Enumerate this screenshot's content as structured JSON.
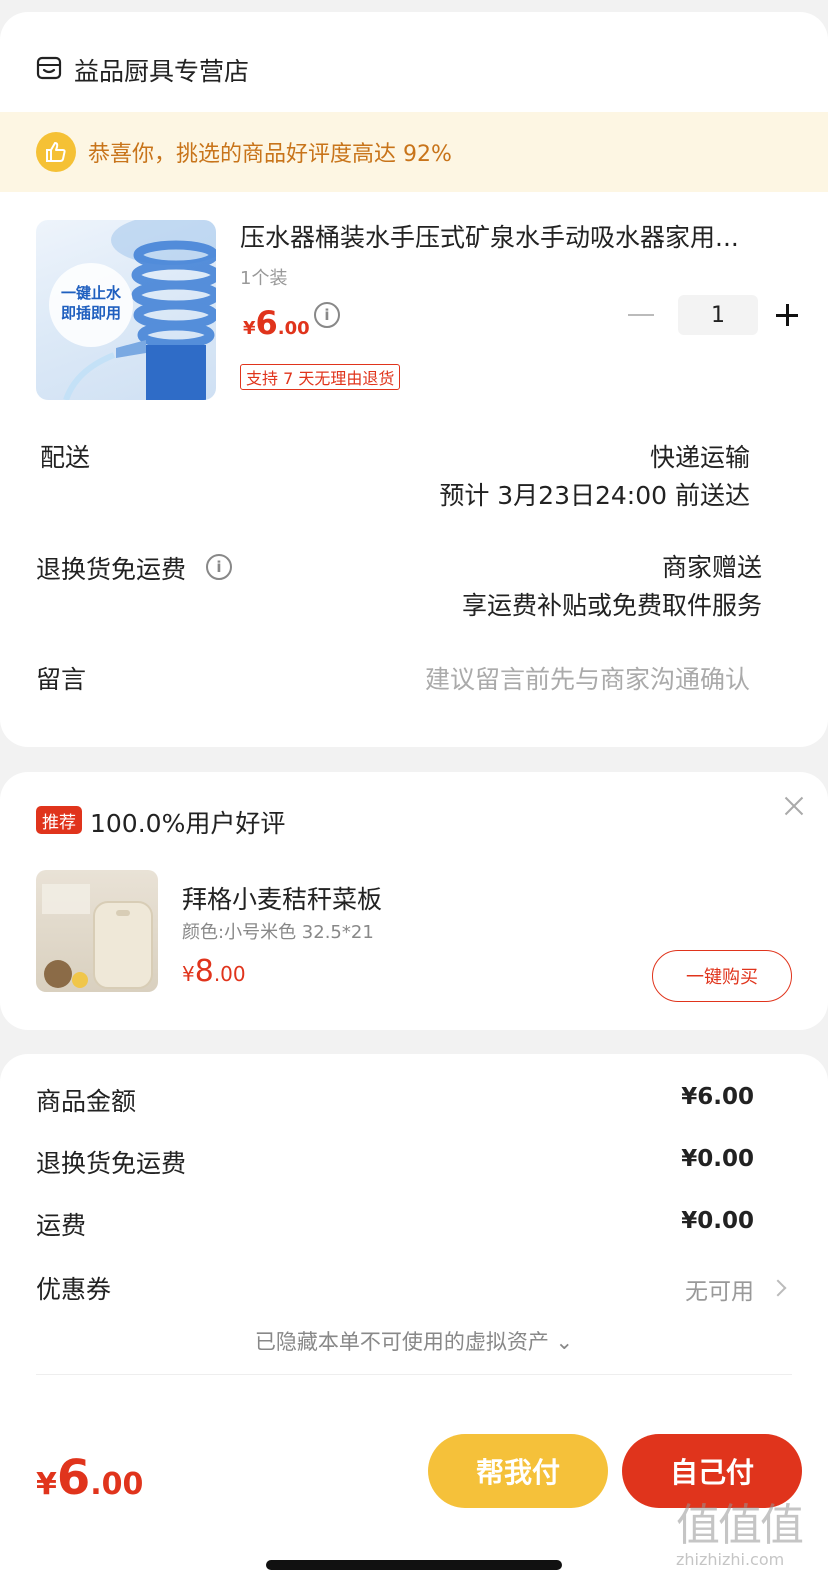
{
  "store": {
    "name": "益品厨具专营店"
  },
  "banner": {
    "text": "恭喜你，挑选的商品好评度高达 92%"
  },
  "product": {
    "title": "压水器桶装水手压式矿泉水手动吸水器家用...",
    "spec": "1个装",
    "price_currency": "¥",
    "price_int": "6",
    "price_dec": ".00",
    "image_caption_line1": "一键止水",
    "image_caption_line2": "即插即用",
    "return_tag": "支持 7 天无理由退货",
    "quantity": "1"
  },
  "delivery": {
    "label": "配送",
    "method": "快递运输",
    "eta": "预计 3月23日24:00 前送达"
  },
  "return_shipping": {
    "label": "退换货免运费",
    "value_line1": "商家赠送",
    "value_line2": "享运费补贴或免费取件服务"
  },
  "message": {
    "label": "留言",
    "placeholder": "建议留言前先与商家沟通确认"
  },
  "recommend": {
    "tag": "推荐",
    "title": "100.0%用户好评",
    "item_name": "拜格小麦秸秆菜板",
    "item_spec": "颜色:小号米色 32.5*21",
    "price_currency": "¥",
    "price_int": "8",
    "price_dec": ".00",
    "buy_label": "一键购买"
  },
  "summary": {
    "goods_label": "商品金额",
    "goods_value": "¥6.00",
    "return_label": "退换货免运费",
    "return_value": "¥0.00",
    "shipping_label": "运费",
    "shipping_value": "¥0.00",
    "coupon_label": "优惠券",
    "coupon_value": "无可用",
    "hidden_note": "已隐藏本单不可使用的虚拟资产 ⌄"
  },
  "footer": {
    "total_currency": "¥",
    "total_int": "6",
    "total_dec": ".00",
    "help_pay": "帮我付",
    "self_pay": "自己付",
    "watermark_logo": "值值值",
    "watermark_url": "zhizhizhi.com"
  },
  "colors": {
    "accent_red": "#e0341c",
    "accent_yellow": "#f5c13a",
    "banner_bg": "#fdf6e3",
    "banner_text": "#c8741a"
  }
}
